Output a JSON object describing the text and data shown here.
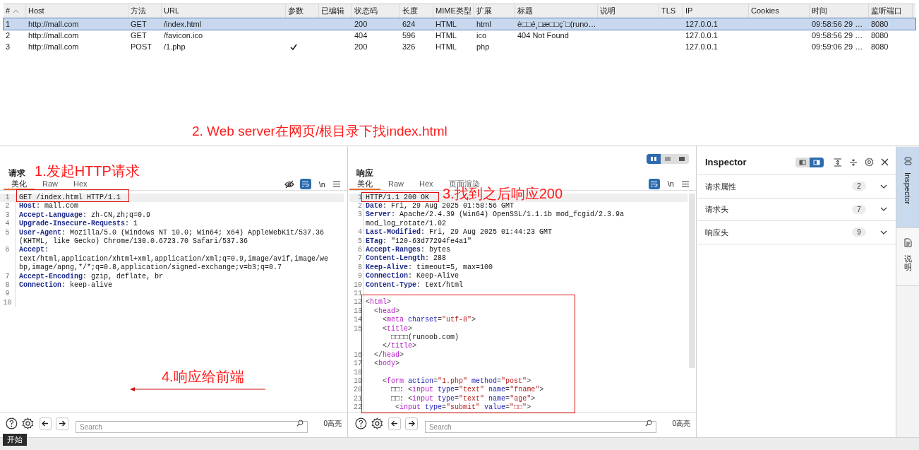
{
  "history": {
    "columns": [
      "#",
      "Host",
      "方法",
      "URL",
      "参数",
      "已编辑",
      "状态码",
      "长度",
      "MIME类型",
      "扩展",
      "标题",
      "说明",
      "TLS",
      "IP",
      "Cookies",
      "时间",
      "监听端口"
    ],
    "rows": [
      {
        "selected": true,
        "params": false,
        "num": "1",
        "host": "http://mall.com",
        "method": "GET",
        "url": "/index.html",
        "status": "200",
        "length": "624",
        "mime": "HTML",
        "ext": "html",
        "title": "è□□é¸□æ□□ç¨□(runo…",
        "ip": "127.0.0.1",
        "time": "09:58:56 29 …",
        "port": "8080"
      },
      {
        "selected": false,
        "params": false,
        "num": "2",
        "host": "http://mall.com",
        "method": "GET",
        "url": "/favicon.ico",
        "status": "404",
        "length": "596",
        "mime": "HTML",
        "ext": "ico",
        "title": "404 Not Found",
        "ip": "127.0.0.1",
        "time": "09:58:56 29 …",
        "port": "8080"
      },
      {
        "selected": false,
        "params": true,
        "num": "3",
        "host": "http://mall.com",
        "method": "POST",
        "url": "/1.php",
        "status": "200",
        "length": "326",
        "mime": "HTML",
        "ext": "php",
        "ip": "127.0.0.1",
        "time": "09:59:06 29 …",
        "port": "8080"
      }
    ]
  },
  "request": {
    "title": "请求",
    "tabs": [
      {
        "label": "美化",
        "selected": true
      },
      {
        "label": "Raw",
        "selected": false
      },
      {
        "label": "Hex",
        "selected": false
      }
    ],
    "wrap_selected": true,
    "newline_label": "\\n",
    "lines": [
      {
        "num": "1",
        "parts": [
          {
            "kind": "text",
            "text": "GET /index.html HTTP/1.1"
          }
        ]
      },
      {
        "num": "2",
        "parts": [
          {
            "kind": "key",
            "text": "Host"
          },
          {
            "kind": "text",
            "text": ": mall.com"
          }
        ]
      },
      {
        "num": "3",
        "parts": [
          {
            "kind": "key",
            "text": "Accept-Language"
          },
          {
            "kind": "text",
            "text": ": zh-CN,zh;q=0.9"
          }
        ]
      },
      {
        "num": "4",
        "parts": [
          {
            "kind": "key",
            "text": "Upgrade-Insecure-Requests"
          },
          {
            "kind": "text",
            "text": ": 1"
          }
        ]
      },
      {
        "num": "5",
        "parts": [
          {
            "kind": "key",
            "text": "User-Agent"
          },
          {
            "kind": "text",
            "text": ": Mozilla/5.0 (Windows NT 10.0; Win64; x64) AppleWebKit/537.36"
          }
        ]
      },
      {
        "parts": [
          {
            "kind": "text",
            "text": "(KHTML, like Gecko) Chrome/130.0.6723.70 Safari/537.36"
          }
        ]
      },
      {
        "num": "6",
        "parts": [
          {
            "kind": "key",
            "text": "Accept"
          },
          {
            "kind": "text",
            "text": ":"
          }
        ]
      },
      {
        "parts": [
          {
            "kind": "text",
            "text": "text/html,application/xhtml+xml,application/xml;q=0.9,image/avif,image/we"
          }
        ]
      },
      {
        "parts": [
          {
            "kind": "text",
            "text": "bp,image/apng,*/*;q=0.8,application/signed-exchange;v=b3;q=0.7"
          }
        ]
      },
      {
        "num": "7",
        "parts": [
          {
            "kind": "key",
            "text": "Accept-Encoding"
          },
          {
            "kind": "text",
            "text": ": gzip, deflate, br"
          }
        ]
      },
      {
        "num": "8",
        "parts": [
          {
            "kind": "key",
            "text": "Connection"
          },
          {
            "kind": "text",
            "text": ": keep-alive"
          }
        ]
      },
      {
        "num": "9"
      },
      {
        "num": "10"
      }
    ],
    "search": {
      "placeholder": "Search"
    },
    "highlights": "0高亮"
  },
  "response": {
    "title": "响应",
    "view_modes": [
      {
        "selected": true
      },
      {
        "selected": false
      },
      {
        "selected": false
      }
    ],
    "tabs": [
      {
        "label": "美化",
        "selected": true
      },
      {
        "label": "Raw",
        "selected": false
      },
      {
        "label": "Hex",
        "selected": false
      },
      {
        "label": "页面渲染",
        "selected": false
      }
    ],
    "wrap_selected": true,
    "newline_label": "\\n",
    "lines": [
      {
        "num": "1",
        "parts": [
          {
            "kind": "text",
            "text": "HTTP/1.1 200 OK"
          }
        ]
      },
      {
        "num": "2",
        "parts": [
          {
            "kind": "key",
            "text": "Date"
          },
          {
            "kind": "text",
            "text": ": Fri, 29 Aug 2025 01:58:56 GMT"
          }
        ]
      },
      {
        "num": "3",
        "parts": [
          {
            "kind": "key",
            "text": "Server"
          },
          {
            "kind": "text",
            "text": ": Apache/2.4.39 (Win64) OpenSSL/1.1.1b mod_fcgid/2.3.9a"
          }
        ]
      },
      {
        "parts": [
          {
            "kind": "text",
            "text": "mod_log_rotate/1.02"
          }
        ]
      },
      {
        "num": "4",
        "parts": [
          {
            "kind": "key",
            "text": "Last-Modified"
          },
          {
            "kind": "text",
            "text": ": Fri, 29 Aug 2025 01:44:23 GMT"
          }
        ]
      },
      {
        "num": "5",
        "parts": [
          {
            "kind": "key",
            "text": "ETag"
          },
          {
            "kind": "text",
            "text": ": \"120-63d77294fe4a1\""
          }
        ]
      },
      {
        "num": "6",
        "parts": [
          {
            "kind": "key",
            "text": "Accept-Ranges"
          },
          {
            "kind": "text",
            "text": ": bytes"
          }
        ]
      },
      {
        "num": "7",
        "parts": [
          {
            "kind": "key",
            "text": "Content-Length"
          },
          {
            "kind": "text",
            "text": ": 288"
          }
        ]
      },
      {
        "num": "8",
        "parts": [
          {
            "kind": "key",
            "text": "Keep-Alive"
          },
          {
            "kind": "text",
            "text": ": timeout=5, max=100"
          }
        ]
      },
      {
        "num": "9",
        "parts": [
          {
            "kind": "key",
            "text": "Connection"
          },
          {
            "kind": "text",
            "text": ": Keep-Alive"
          }
        ]
      },
      {
        "num": "10",
        "parts": [
          {
            "kind": "key",
            "text": "Content-Type"
          },
          {
            "kind": "text",
            "text": ": text/html"
          }
        ]
      },
      {
        "num": "11"
      },
      {
        "num": "12",
        "parts": [
          {
            "kind": "punct",
            "text": "<"
          },
          {
            "kind": "tag",
            "text": "html"
          },
          {
            "kind": "punct",
            "text": ">"
          }
        ]
      },
      {
        "num": "13",
        "parts": [
          {
            "kind": "punct",
            "text": "  <"
          },
          {
            "kind": "tag",
            "text": "head"
          },
          {
            "kind": "punct",
            "text": ">"
          }
        ]
      },
      {
        "num": "14",
        "parts": [
          {
            "kind": "punct",
            "text": "    <"
          },
          {
            "kind": "tag",
            "text": "meta"
          },
          {
            "kind": "attr",
            "text": " charset"
          },
          {
            "kind": "punct",
            "text": "="
          },
          {
            "kind": "str",
            "text": "\"utf-8\""
          },
          {
            "kind": "punct",
            "text": ">"
          }
        ]
      },
      {
        "num": "15",
        "parts": [
          {
            "kind": "punct",
            "text": "    <"
          },
          {
            "kind": "tag",
            "text": "title"
          },
          {
            "kind": "punct",
            "text": ">"
          }
        ]
      },
      {
        "parts": [
          {
            "kind": "text",
            "text": "      □□□□(runoob.com)"
          }
        ]
      },
      {
        "parts": [
          {
            "kind": "punct",
            "text": "    </"
          },
          {
            "kind": "tag",
            "text": "title"
          },
          {
            "kind": "punct",
            "text": ">"
          }
        ]
      },
      {
        "num": "16",
        "parts": [
          {
            "kind": "punct",
            "text": "  </"
          },
          {
            "kind": "tag",
            "text": "head"
          },
          {
            "kind": "punct",
            "text": ">"
          }
        ]
      },
      {
        "num": "17",
        "parts": [
          {
            "kind": "punct",
            "text": "  <"
          },
          {
            "kind": "tag",
            "text": "body"
          },
          {
            "kind": "punct",
            "text": ">"
          }
        ]
      },
      {
        "num": "18"
      },
      {
        "num": "19",
        "parts": [
          {
            "kind": "punct",
            "text": "    <"
          },
          {
            "kind": "tag",
            "text": "form"
          },
          {
            "kind": "attr",
            "text": " action"
          },
          {
            "kind": "punct",
            "text": "="
          },
          {
            "kind": "str",
            "text": "\"1.php\""
          },
          {
            "kind": "attr",
            "text": " method"
          },
          {
            "kind": "punct",
            "text": "="
          },
          {
            "kind": "str",
            "text": "\"post\""
          },
          {
            "kind": "punct",
            "text": ">"
          }
        ]
      },
      {
        "num": "20",
        "parts": [
          {
            "kind": "text",
            "text": "      □□: "
          },
          {
            "kind": "punct",
            "text": "<"
          },
          {
            "kind": "tag",
            "text": "input"
          },
          {
            "kind": "attr",
            "text": " type"
          },
          {
            "kind": "punct",
            "text": "="
          },
          {
            "kind": "str",
            "text": "\"text\""
          },
          {
            "kind": "attr",
            "text": " name"
          },
          {
            "kind": "punct",
            "text": "="
          },
          {
            "kind": "str",
            "text": "\"fname\""
          },
          {
            "kind": "punct",
            "text": ">"
          }
        ]
      },
      {
        "num": "21",
        "parts": [
          {
            "kind": "text",
            "text": "      □□: "
          },
          {
            "kind": "punct",
            "text": "<"
          },
          {
            "kind": "tag",
            "text": "input"
          },
          {
            "kind": "attr",
            "text": " type"
          },
          {
            "kind": "punct",
            "text": "="
          },
          {
            "kind": "str",
            "text": "\"text\""
          },
          {
            "kind": "attr",
            "text": " name"
          },
          {
            "kind": "punct",
            "text": "="
          },
          {
            "kind": "str",
            "text": "\"age\""
          },
          {
            "kind": "punct",
            "text": ">"
          }
        ]
      },
      {
        "num": "22",
        "parts": [
          {
            "kind": "punct",
            "text": "       <"
          },
          {
            "kind": "tag",
            "text": "input"
          },
          {
            "kind": "attr",
            "text": " type"
          },
          {
            "kind": "punct",
            "text": "="
          },
          {
            "kind": "str",
            "text": "\"submit\""
          },
          {
            "kind": "attr",
            "text": " value"
          },
          {
            "kind": "punct",
            "text": "="
          },
          {
            "kind": "str",
            "text": "\"□□\""
          },
          {
            "kind": "punct",
            "text": ">"
          }
        ]
      }
    ],
    "search": {
      "placeholder": "Search"
    },
    "highlights": "0高亮"
  },
  "inspector": {
    "title": "Inspector",
    "layout_buttons": [
      {
        "selected": false
      },
      {
        "selected": true
      }
    ],
    "sections": [
      {
        "label": "请求属性",
        "count": "2",
        "expanded": false
      },
      {
        "label": "请求头",
        "count": "7",
        "expanded": false
      },
      {
        "label": "响应头",
        "count": "9",
        "expanded": false
      }
    ]
  },
  "side_tabs": [
    {
      "label": "Inspector",
      "selected": true,
      "kind": "latin"
    },
    {
      "label": "说明",
      "selected": false,
      "kind": "cjk"
    }
  ],
  "tooltip": "开始",
  "annotations": [
    {
      "kind": "note",
      "text": "2. Web server在网页/根目录下找index.html"
    },
    {
      "kind": "note",
      "text": "1.发起HTTP请求"
    },
    {
      "kind": "note",
      "text": "3.找到之后响应200"
    },
    {
      "kind": "note",
      "text": "4.响应给前端"
    }
  ]
}
